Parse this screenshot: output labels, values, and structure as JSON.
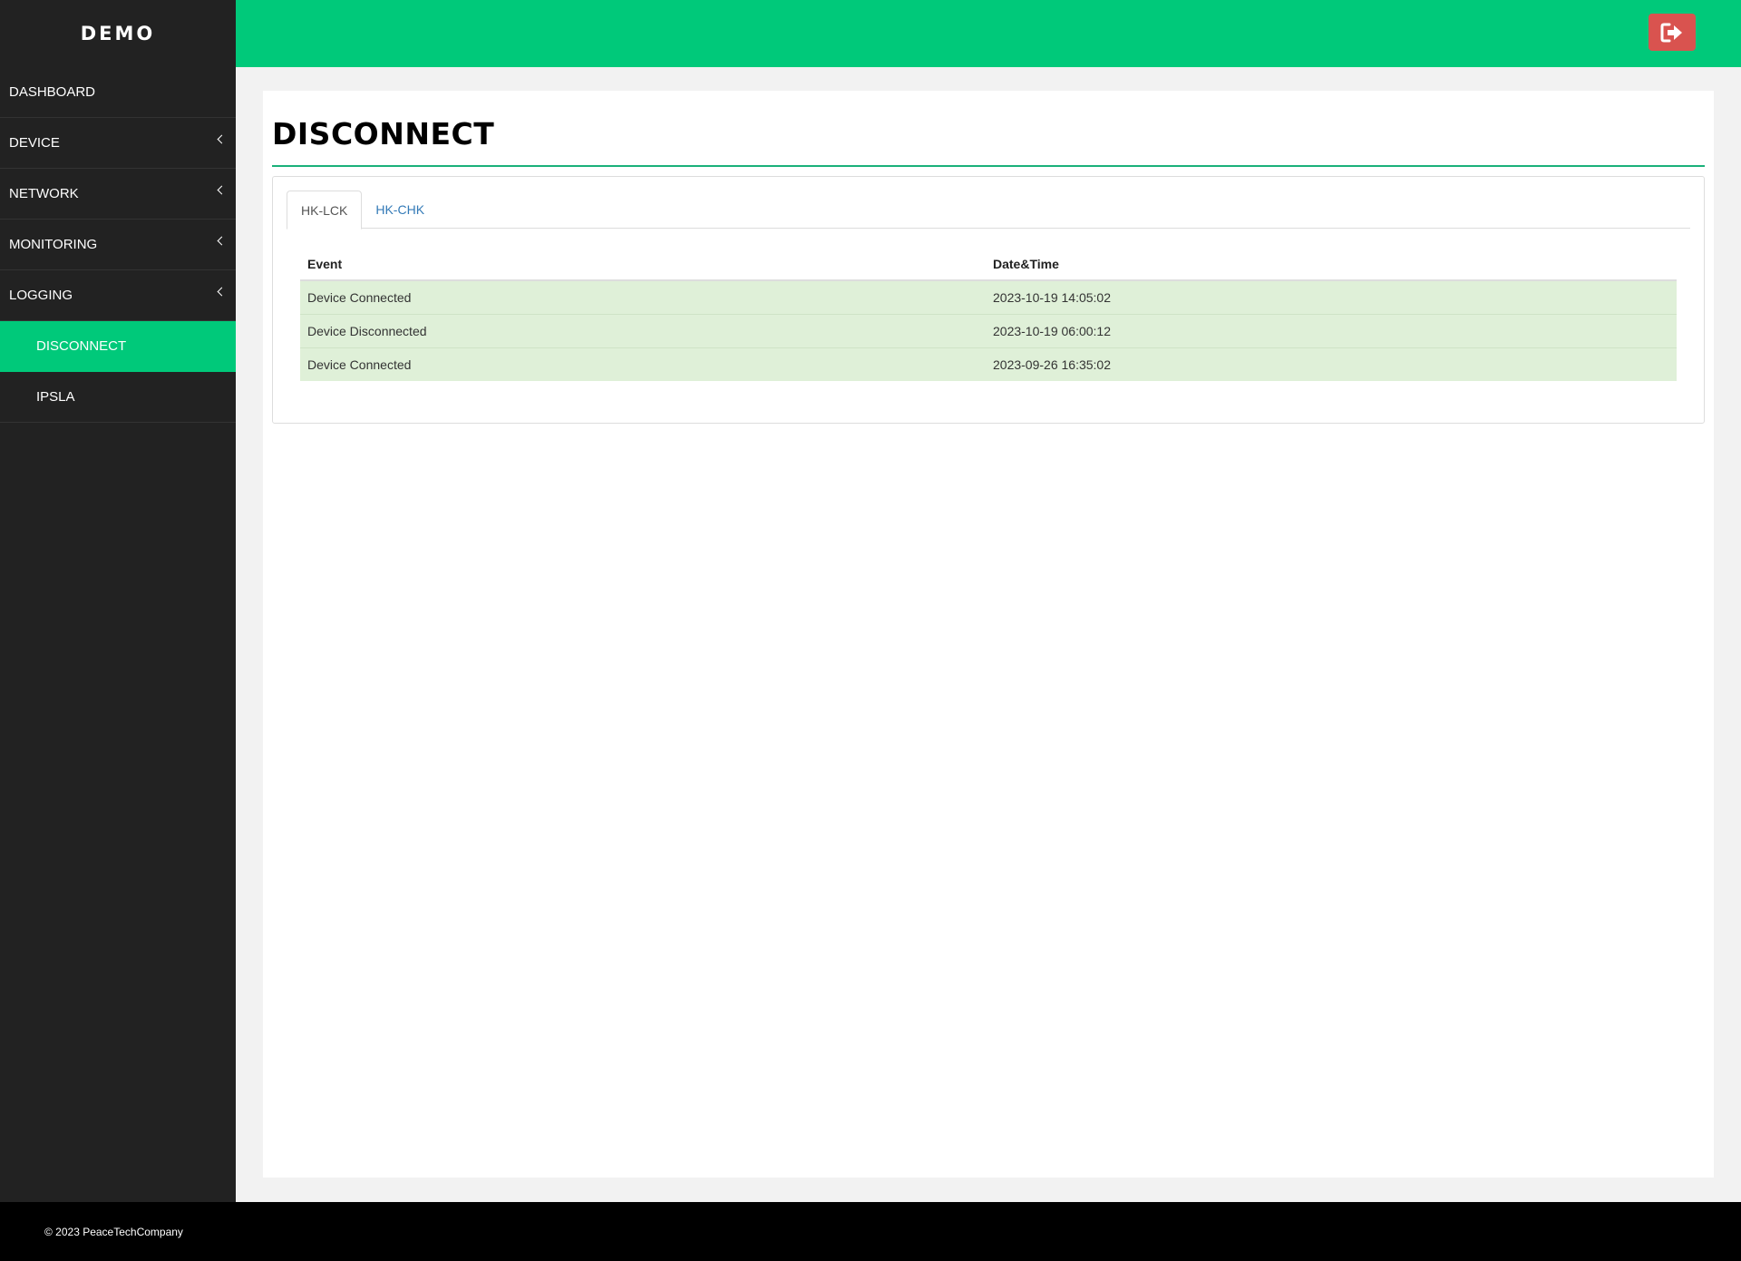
{
  "brand": {
    "title": "DEMO"
  },
  "sidebar": {
    "items": [
      {
        "label": "DASHBOARD",
        "has_submenu": false
      },
      {
        "label": "DEVICE",
        "has_submenu": true
      },
      {
        "label": "NETWORK",
        "has_submenu": true
      },
      {
        "label": "MONITORING",
        "has_submenu": true
      },
      {
        "label": "LOGGING",
        "has_submenu": true
      }
    ],
    "subitems": [
      {
        "label": "DISCONNECT",
        "active": true
      },
      {
        "label": "IPSLA",
        "active": false
      }
    ]
  },
  "header": {
    "logout_icon": "sign-out-icon",
    "accent_color": "#00c97a",
    "logout_color": "#d9534f"
  },
  "main": {
    "title": "DISCONNECT",
    "tabs": [
      {
        "label": "HK-LCK",
        "active": true
      },
      {
        "label": "HK-CHK",
        "active": false
      }
    ],
    "table": {
      "columns": [
        "Event",
        "Date&Time"
      ],
      "rows": [
        [
          "Device Connected",
          "2023-10-19 14:05:02"
        ],
        [
          "Device Disconnected",
          "2023-10-19 06:00:12"
        ],
        [
          "Device Connected",
          "2023-09-26 16:35:02"
        ]
      ]
    }
  },
  "footer": {
    "text": "© 2023 PeaceTechCompany"
  }
}
